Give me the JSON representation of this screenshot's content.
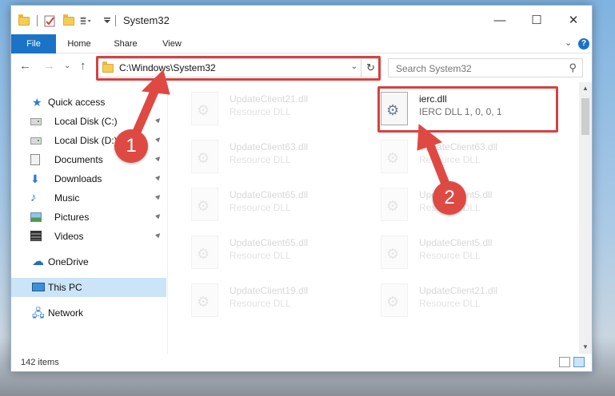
{
  "window": {
    "title": "System32",
    "controls": {
      "minimize": "—",
      "maximize": "☐",
      "close": "✕"
    }
  },
  "ribbon": {
    "tabs": [
      "File",
      "Home",
      "Share",
      "View"
    ],
    "collapse": "⌄",
    "help": "?"
  },
  "nav": {
    "back": "←",
    "forward": "→",
    "recent": "⌄",
    "up": "↑",
    "address": "C:\\Windows\\System32",
    "address_dropdown": "⌄",
    "refresh": "↻",
    "search_placeholder": "Search System32",
    "search_icon": "⚲"
  },
  "sidebar": {
    "quick_access": "Quick access",
    "items": [
      {
        "label": "Local Disk (C:)",
        "icon": "drive-icon"
      },
      {
        "label": "Local Disk (D:)",
        "icon": "drive-icon"
      },
      {
        "label": "Documents",
        "icon": "documents-icon"
      },
      {
        "label": "Downloads",
        "icon": "downloads-icon"
      },
      {
        "label": "Music",
        "icon": "music-icon"
      },
      {
        "label": "Pictures",
        "icon": "pictures-icon"
      },
      {
        "label": "Videos",
        "icon": "videos-icon"
      }
    ],
    "pin_glyph": "📌",
    "onedrive": "OneDrive",
    "this_pc": "This PC",
    "network": "Network"
  },
  "files": [
    {
      "name": "UpdateClient21.dll",
      "desc": "Resource DLL"
    },
    {
      "name": "ierc.dll",
      "desc": "IERC DLL 1, 0, 0, 1"
    },
    {
      "name": "UpdateClient63.dll",
      "desc": "Resource DLL"
    },
    {
      "name": "UpdateClient63.dll",
      "desc": "Resource DLL"
    },
    {
      "name": "UpdateClient65.dll",
      "desc": "Resource DLL"
    },
    {
      "name": "UpdateClient5.dll",
      "desc": "Resource DLL"
    },
    {
      "name": "UpdateClient65.dll",
      "desc": "Resource DLL"
    },
    {
      "name": "UpdateClient5.dll",
      "desc": "Resource DLL"
    },
    {
      "name": "UpdateClient19.dll",
      "desc": "Resource DLL"
    },
    {
      "name": "UpdateClient21.dll",
      "desc": "Resource DLL"
    }
  ],
  "status": {
    "items": "142 items"
  },
  "callouts": {
    "step1": "1",
    "step2": "2"
  },
  "colors": {
    "accent": "#1a73c7",
    "highlight": "#d64141",
    "selection": "#cce4f7"
  }
}
